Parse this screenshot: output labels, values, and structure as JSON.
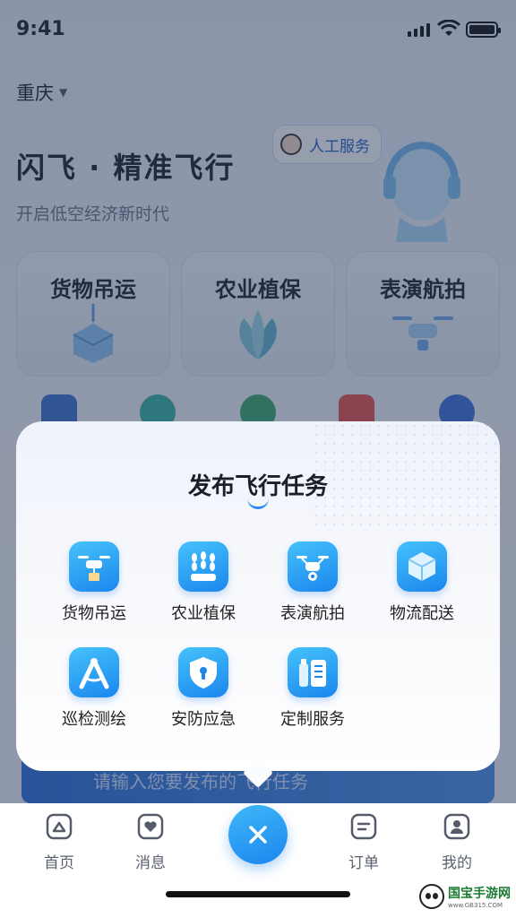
{
  "status": {
    "time": "9:41"
  },
  "header": {
    "city": "重庆",
    "title": "闪飞 · 精准飞行",
    "subtitle": "开启低空经济新时代",
    "service_label": "人工服务"
  },
  "cards": [
    {
      "label": "货物吊运"
    },
    {
      "label": "农业植保"
    },
    {
      "label": "表演航拍"
    }
  ],
  "banner": {
    "text": "请输入您要发布的飞行任务"
  },
  "modal": {
    "title": "发布飞行任务",
    "items": [
      {
        "label": "货物吊运",
        "icon": "drone-cargo-icon"
      },
      {
        "label": "农业植保",
        "icon": "wheat-icon"
      },
      {
        "label": "表演航拍",
        "icon": "drone-camera-icon"
      },
      {
        "label": "物流配送",
        "icon": "package-cube-icon"
      },
      {
        "label": "巡检测绘",
        "icon": "compass-icon"
      },
      {
        "label": "安防应急",
        "icon": "shield-lock-icon"
      },
      {
        "label": "定制服务",
        "icon": "custom-bottle-icon"
      }
    ]
  },
  "tabbar": {
    "tabs": [
      {
        "label": "首页"
      },
      {
        "label": "消息"
      },
      {
        "label": "订单"
      },
      {
        "label": "我的"
      }
    ]
  },
  "watermark": {
    "name": "国宝手游网",
    "url": "www.GB315.COM"
  },
  "colors": {
    "accent": "#1b86ee",
    "accent_light": "#45c2fb",
    "text": "#1b1f2a"
  }
}
